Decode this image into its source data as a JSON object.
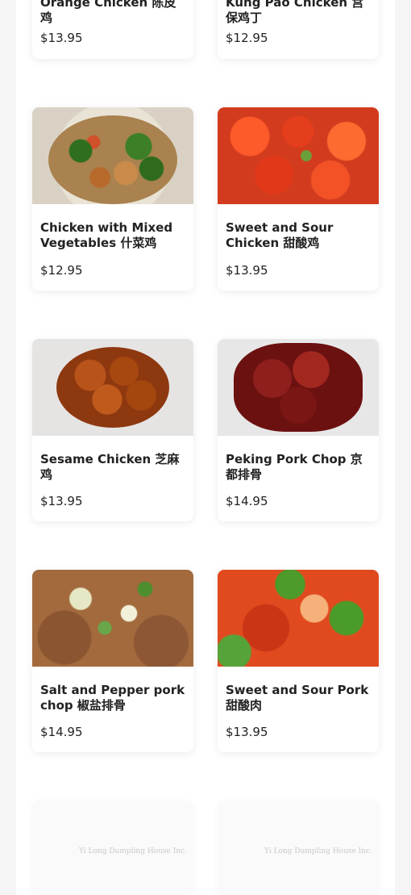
{
  "menu": {
    "items": [
      {
        "name": "Orange Chicken 陈皮鸡",
        "price": "$13.95"
      },
      {
        "name": "Kung Pao Chicken 宫保鸡丁",
        "price": "$12.95"
      },
      {
        "name": "Chicken with Mixed Vegetables 什菜鸡",
        "price": "$12.95"
      },
      {
        "name": "Sweet and Sour Chicken 甜酸鸡",
        "price": "$13.95"
      },
      {
        "name": "Sesame Chicken 芝麻鸡",
        "price": "$13.95"
      },
      {
        "name": "Peking Pork Chop 京都排骨",
        "price": "$14.95"
      },
      {
        "name": "Salt and Pepper pork chop 椒盐排骨",
        "price": "$14.95"
      },
      {
        "name": "Sweet and Sour Pork 甜酸肉",
        "price": "$13.95"
      }
    ]
  },
  "placeholders": {
    "logo_text": "Yi Long Dumpling House Inc."
  }
}
